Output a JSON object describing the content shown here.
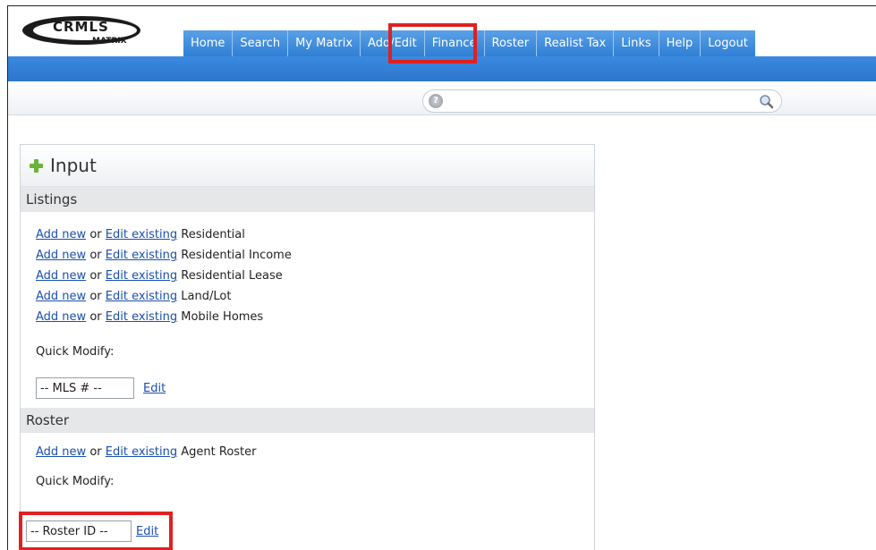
{
  "logo": {
    "brand": "CRMLS",
    "product": "MATRIX"
  },
  "nav": {
    "items": [
      "Home",
      "Search",
      "My Matrix",
      "Add/Edit",
      "Finance",
      "Roster",
      "Realist Tax",
      "Links",
      "Help",
      "Logout"
    ],
    "active": "Add/Edit"
  },
  "search": {
    "value": "",
    "help_icon_glyph": "?"
  },
  "panel": {
    "title": "Input",
    "listings": {
      "heading": "Listings",
      "rows": [
        {
          "add": "Add new",
          "or": "or",
          "edit": "Edit existing",
          "type": "Residential"
        },
        {
          "add": "Add new",
          "or": "or",
          "edit": "Edit existing",
          "type": "Residential Income"
        },
        {
          "add": "Add new",
          "or": "or",
          "edit": "Edit existing",
          "type": "Residential Lease"
        },
        {
          "add": "Add new",
          "or": "or",
          "edit": "Edit existing",
          "type": "Land/Lot"
        },
        {
          "add": "Add new",
          "or": "or",
          "edit": "Edit existing",
          "type": "Mobile Homes"
        }
      ],
      "quick_modify_label": "Quick Modify:",
      "mls_input_value": "-- MLS # --",
      "edit_label": "Edit"
    },
    "roster": {
      "heading": "Roster",
      "row": {
        "add": "Add new",
        "or": "or",
        "edit": "Edit existing",
        "type": "Agent Roster"
      },
      "quick_modify_label": "Quick Modify:",
      "roster_input_value": "-- Roster ID --",
      "edit_label": "Edit"
    }
  },
  "colors": {
    "nav_blue": "#2f7fd6",
    "highlight_red": "#e02020",
    "link_blue": "#1a4fb0"
  }
}
